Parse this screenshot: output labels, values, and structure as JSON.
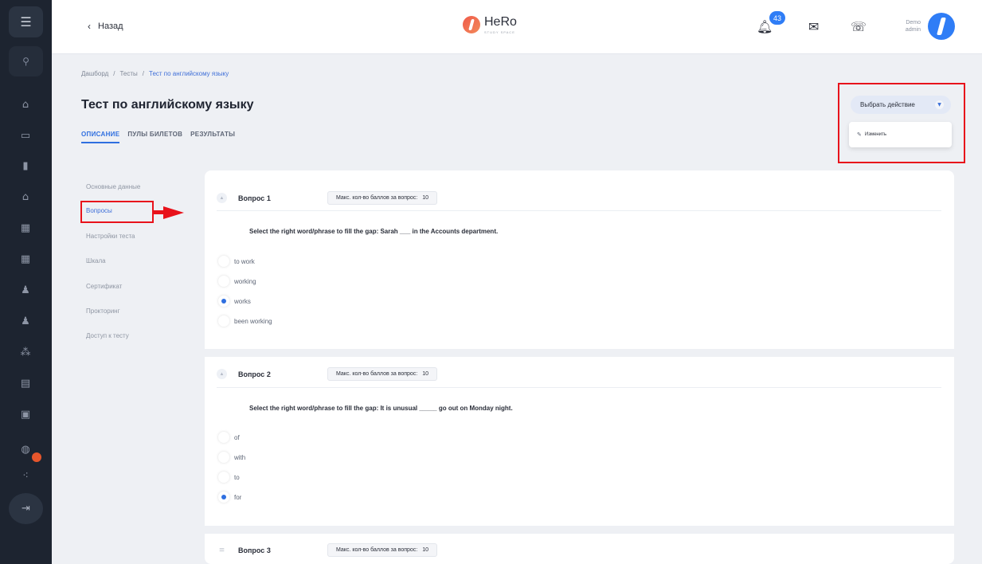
{
  "header": {
    "back_label": "Назад",
    "logo_text": "HeRo",
    "logo_sub": "STUDY SPACE",
    "notifications_count": "43",
    "user_name": "Demo",
    "user_role": "admin"
  },
  "breadcrumb": [
    "Дашборд",
    "Тесты",
    "Тест по английскому языку"
  ],
  "page": {
    "title": "Тест по английскому языку",
    "tabs": [
      "ОПИСАНИЕ",
      "ПУЛЫ БИЛЕТОВ",
      "РЕЗУЛЬТАТЫ"
    ],
    "active_tab": 0
  },
  "actions": {
    "button_label": "Выбрать действие",
    "dropdown_items": [
      "Изменить"
    ]
  },
  "submenu": {
    "items": [
      "Основные данные",
      "Вопросы",
      "Настройки теста",
      "Шкала",
      "Сертификат",
      "Прокторинг",
      "Доступ к тесту"
    ],
    "active": 1
  },
  "questions": [
    {
      "label": "Вопрос 1",
      "max_label": "Макс. кол-во баллов за вопрос:",
      "max_value": "10",
      "text": "Select the right word/phrase to fill the gap: Sarah ___ in the Accounts department.",
      "options": [
        "to work",
        "working",
        "works",
        "been working"
      ],
      "selected": 2
    },
    {
      "label": "Вопрос 2",
      "max_label": "Макс. кол-во баллов за вопрос:",
      "max_value": "10",
      "text": "Select the right word/phrase to fill the gap: It is unusual _____ go out on Monday night.",
      "options": [
        "of",
        "with",
        "to",
        "for"
      ],
      "selected": 3
    },
    {
      "label": "Вопрос 3",
      "max_label": "Макс. кол-во баллов за вопрос:",
      "max_value": "10"
    }
  ],
  "colors": {
    "accent": "#2f6fe0",
    "sidebar": "#1d2430",
    "highlight": "#e8121b",
    "badge": "#2f7df6"
  },
  "icons": {
    "sidebar": [
      "menu-icon",
      "search-icon",
      "home-icon",
      "monitor-icon",
      "book-icon",
      "graduation-icon",
      "calendar-icon",
      "grid-icon",
      "user-icon",
      "person-icon",
      "group-icon",
      "document-icon",
      "card-icon",
      "globe-icon",
      "org-icon",
      "logout-icon"
    ]
  }
}
